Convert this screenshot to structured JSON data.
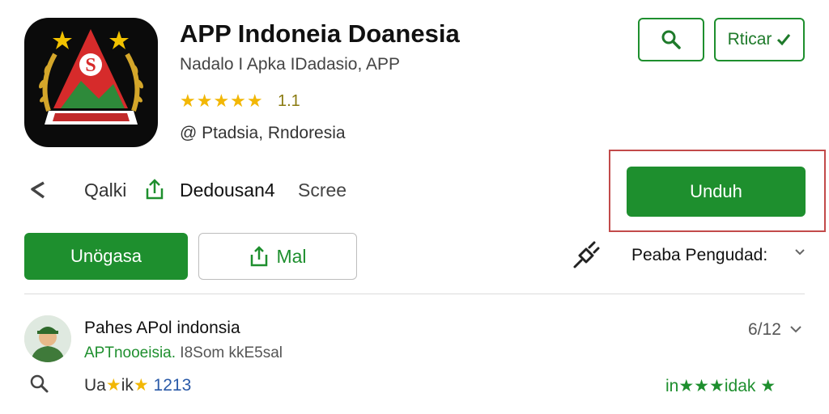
{
  "app": {
    "title": "APP Indoneia Doanesia",
    "subtitle": "Nadalo I Apka IDadasio, APP",
    "stars": "★★★★★",
    "rating": "1.1",
    "developer": "@ Ptadsia, Rndoresia"
  },
  "header": {
    "search_icon": "search-icon",
    "filter_label": "Rticar",
    "filter_icon": "check-icon"
  },
  "info_row": {
    "share_icon": "share-icon",
    "qalki": "Qalki",
    "upload_icon": "upload-icon",
    "dedousan": "Dedousan4",
    "scree": "Scree"
  },
  "actions": {
    "download_label": "Unduh",
    "primary_label": "Unögasa",
    "mail_label": "Mal",
    "mail_icon": "upload-icon"
  },
  "language": {
    "label": "Peaba Pengudad:",
    "icon": "plug-icon"
  },
  "review": {
    "name": "Pahes APol indonsia",
    "source_green": "APTnooeisia.",
    "source_rest": " I8Som kkE5sal",
    "count": "6/12",
    "left_text_a": "Ua",
    "left_text_b": "ik",
    "left_number": "1213",
    "right_text_a": "in",
    "right_text_b": "idak"
  },
  "colors": {
    "accent_green": "#1e8f2e",
    "star_yellow": "#f2b705",
    "highlight_red": "#c24a4a"
  }
}
